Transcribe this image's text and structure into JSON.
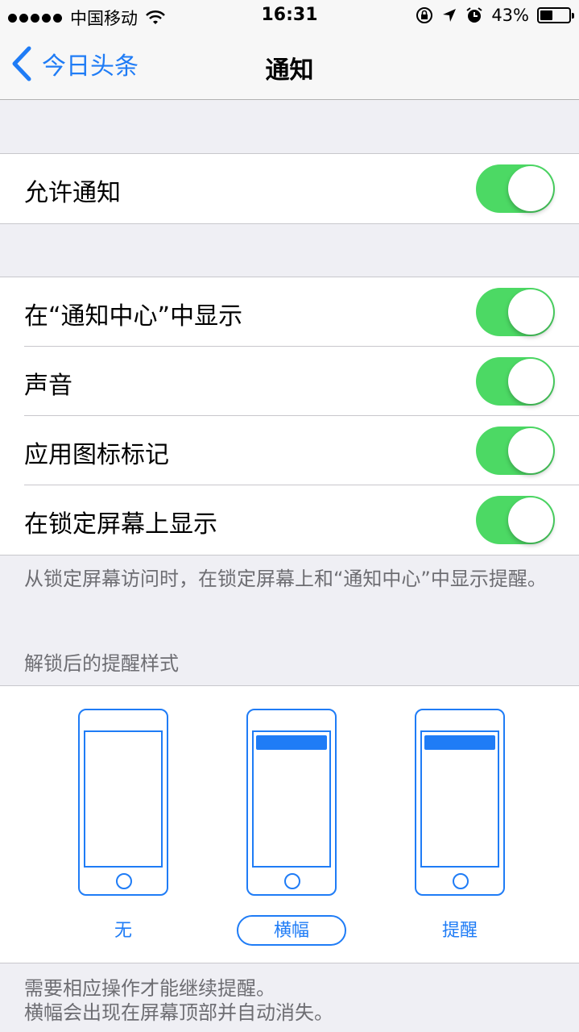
{
  "status_bar": {
    "carrier": "中国移动",
    "time": "16:31",
    "battery_percent": "43%",
    "battery_level": 0.43
  },
  "nav": {
    "back_label": "今日头条",
    "title": "通知"
  },
  "allow_group": {
    "allow_notifications": {
      "label": "允许通知",
      "on": true
    }
  },
  "settings_group": {
    "show_in_center": {
      "label": "在“通知中心”中显示",
      "on": true
    },
    "sounds": {
      "label": "声音",
      "on": true
    },
    "badge_app_icon": {
      "label": "应用图标标记",
      "on": true
    },
    "show_on_lock_screen": {
      "label": "在锁定屏幕上显示",
      "on": true
    }
  },
  "lock_screen_footnote": "从锁定屏幕访问时，在锁定屏幕上和“通知中心”中显示提醒。",
  "alert_style": {
    "header": "解锁后的提醒样式",
    "options": [
      "无",
      "横幅",
      "提醒"
    ],
    "selected": "横幅",
    "footnote_line1": "需要相应操作才能继续提醒。",
    "footnote_line2": "横幅会出现在屏幕顶部并自动消失。"
  },
  "colors": {
    "accent": "#1f7cf6",
    "toggle_on": "#4cd964",
    "background": "#efeff4"
  }
}
